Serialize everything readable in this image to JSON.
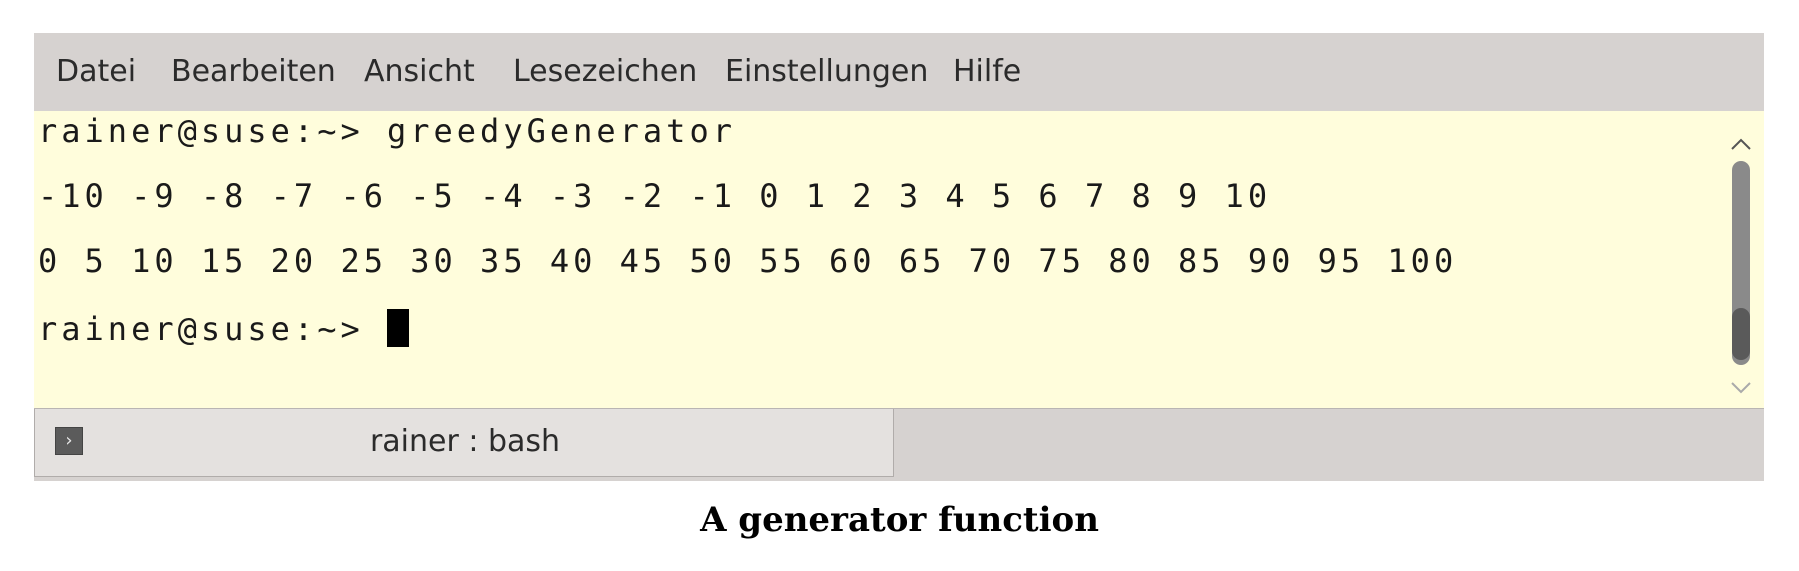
{
  "menu": {
    "items": [
      "Datei",
      "Bearbeiten",
      "Ansicht",
      "Lesezeichen",
      "Einstellungen",
      "Hilfe"
    ]
  },
  "terminal": {
    "lines": [
      "rainer@suse:~> greedyGenerator",
      "-10 -9 -8 -7 -6 -5 -4 -3 -2 -1 0 1 2 3 4 5 6 7 8 9 10",
      "0 5 10 15 20 25 30 35 40 45 50 55 60 65 70 75 80 85 90 95 100",
      "rainer@suse:~> "
    ],
    "background": "#fffddc"
  },
  "scrollbar": {
    "up_icon": "chevron-up-icon",
    "down_icon": "chevron-down-icon"
  },
  "tab": {
    "icon": "terminal-prompt-icon",
    "label": "rainer : bash"
  },
  "caption": "A generator function"
}
